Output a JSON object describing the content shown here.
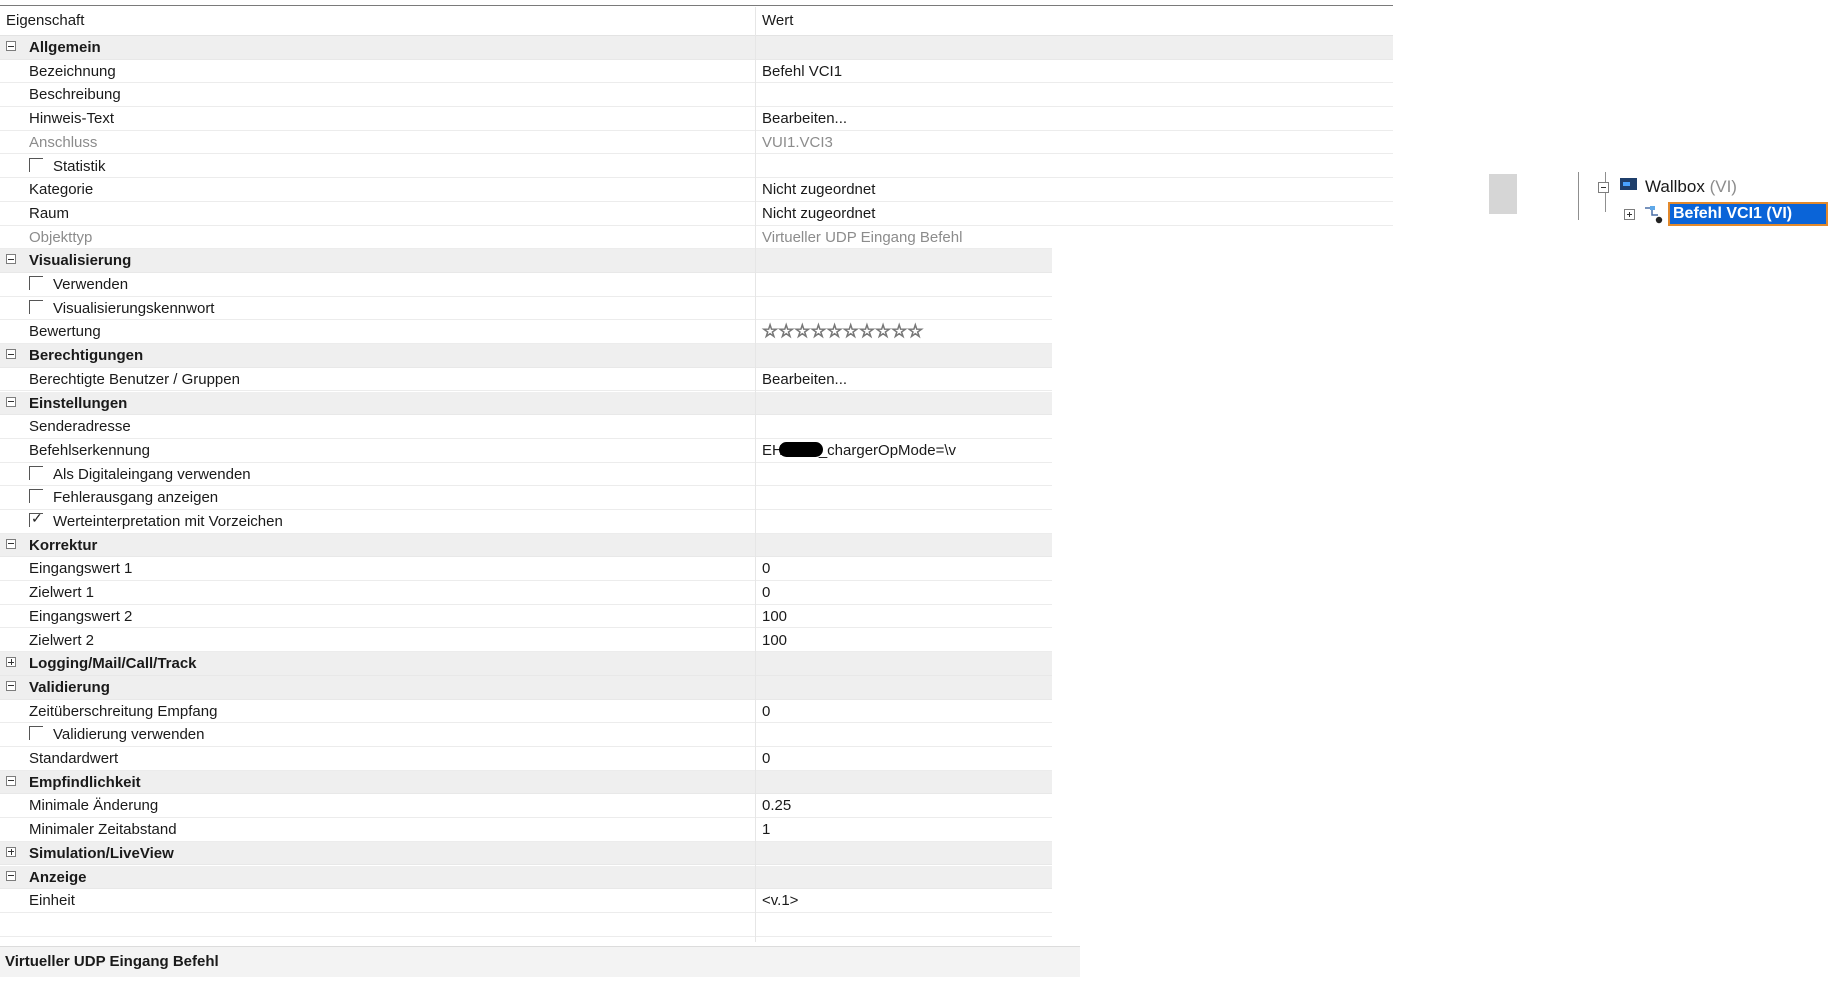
{
  "header": {
    "col_property": "Eigenschaft",
    "col_value": "Wert"
  },
  "rows": [
    {
      "type": "cat",
      "expanded": true,
      "name": "Allgemein",
      "value": ""
    },
    {
      "type": "prop",
      "name": "Bezeichnung",
      "value": "Befehl VCI1"
    },
    {
      "type": "prop",
      "name": "Beschreibung",
      "value": ""
    },
    {
      "type": "prop",
      "name": "Hinweis-Text",
      "value": "Bearbeiten..."
    },
    {
      "type": "prop",
      "readonly": true,
      "name": "Anschluss",
      "value": "VUI1.VCI3"
    },
    {
      "type": "check",
      "checked": false,
      "name": "Statistik",
      "value": ""
    },
    {
      "type": "prop",
      "name": "Kategorie",
      "value": "Nicht zugeordnet"
    },
    {
      "type": "prop",
      "name": "Raum",
      "value": "Nicht zugeordnet"
    },
    {
      "type": "prop",
      "readonly": true,
      "name": "Objekttyp",
      "value": "Virtueller UDP Eingang Befehl"
    },
    {
      "type": "cat",
      "expanded": true,
      "name": "Visualisierung",
      "value": ""
    },
    {
      "type": "check",
      "checked": false,
      "name": "Verwenden",
      "value": ""
    },
    {
      "type": "check",
      "checked": false,
      "name": "Visualisierungskennwort",
      "value": ""
    },
    {
      "type": "stars",
      "name": "Bewertung",
      "value": "☆☆☆☆☆☆☆☆☆☆"
    },
    {
      "type": "cat",
      "expanded": true,
      "name": "Berechtigungen",
      "value": ""
    },
    {
      "type": "prop",
      "name": "Berechtigte Benutzer / Gruppen",
      "value": "Bearbeiten..."
    },
    {
      "type": "cat",
      "expanded": true,
      "name": "Einstellungen",
      "value": ""
    },
    {
      "type": "prop",
      "name": "Senderadresse",
      "value": ""
    },
    {
      "type": "redacted",
      "name": "Befehlserkennung",
      "value_prefix": "EH",
      "value_suffix": "_chargerOpMode=\\v"
    },
    {
      "type": "check",
      "checked": false,
      "name": "Als Digitaleingang verwenden",
      "value": ""
    },
    {
      "type": "check",
      "checked": false,
      "name": "Fehlerausgang anzeigen",
      "value": ""
    },
    {
      "type": "check",
      "checked": true,
      "name": "Werteinterpretation mit Vorzeichen",
      "value": ""
    },
    {
      "type": "cat",
      "expanded": true,
      "name": "Korrektur",
      "value": ""
    },
    {
      "type": "prop",
      "name": "Eingangswert 1",
      "value": "0"
    },
    {
      "type": "prop",
      "name": "Zielwert 1",
      "value": "0"
    },
    {
      "type": "prop",
      "name": "Eingangswert 2",
      "value": "100"
    },
    {
      "type": "prop",
      "name": "Zielwert 2",
      "value": "100"
    },
    {
      "type": "cat",
      "expanded": false,
      "name": "Logging/Mail/Call/Track",
      "value": ""
    },
    {
      "type": "cat",
      "expanded": true,
      "name": "Validierung",
      "value": ""
    },
    {
      "type": "prop",
      "name": "Zeitüberschreitung Empfang",
      "value": "0"
    },
    {
      "type": "check",
      "checked": false,
      "name": "Validierung verwenden",
      "value": ""
    },
    {
      "type": "prop",
      "name": "Standardwert",
      "value": "0"
    },
    {
      "type": "cat",
      "expanded": true,
      "name": "Empfindlichkeit",
      "value": ""
    },
    {
      "type": "prop",
      "name": "Minimale Änderung",
      "value": "0.25"
    },
    {
      "type": "prop",
      "name": "Minimaler Zeitabstand",
      "value": "1"
    },
    {
      "type": "cat",
      "expanded": false,
      "name": "Simulation/LiveView",
      "value": ""
    },
    {
      "type": "cat",
      "expanded": true,
      "name": "Anzeige",
      "value": ""
    },
    {
      "type": "prop",
      "name": "Einheit",
      "value": "<v.1>"
    },
    {
      "type": "prop",
      "name": "",
      "value": ""
    }
  ],
  "footer": {
    "description": "Virtueller UDP Eingang Befehl"
  },
  "tree": {
    "parent": {
      "label": "Wallbox",
      "suffix": "(VI)",
      "expanded": true
    },
    "child": {
      "label": "Befehl VCI1 (VI)",
      "selected": true,
      "expanded": false
    }
  }
}
